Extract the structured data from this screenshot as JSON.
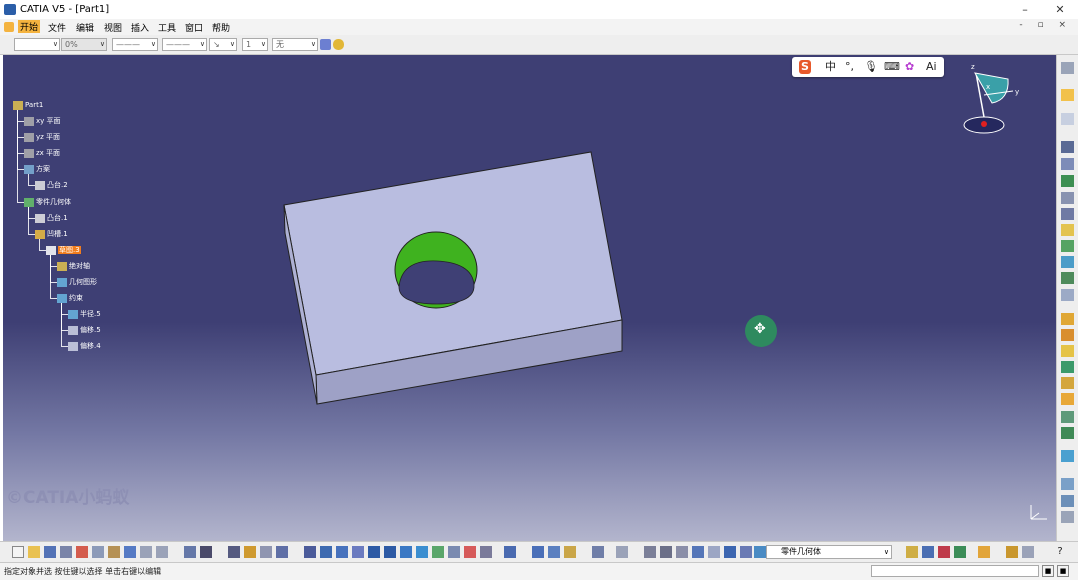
{
  "window": {
    "title": "CATIA V5 - [Part1]",
    "minimize": "–",
    "maximize": "□",
    "close": "✕"
  },
  "menu": {
    "items": [
      "开始",
      "文件",
      "编辑",
      "视图",
      "插入",
      "工具",
      "窗口",
      "帮助"
    ],
    "active_index": 0,
    "doc_controls": "- ▫ ×"
  },
  "format_toolbar": {
    "font_combo": "",
    "percent_combo": "0%",
    "line_type_combo": "———",
    "line_weight_combo": "———",
    "arrow_combo": "↘",
    "layer_combo": "1",
    "filter_combo": "无"
  },
  "spec_tree": {
    "nodes": [
      {
        "label": "Part1",
        "icon": "part-icon",
        "level": 0
      },
      {
        "label": "xy 平面",
        "icon": "plane-icon",
        "level": 1
      },
      {
        "label": "yz 平面",
        "icon": "plane-icon",
        "level": 1
      },
      {
        "label": "zx 平面",
        "icon": "plane-icon",
        "level": 1
      },
      {
        "label": "方案",
        "icon": "sketch-folder-icon",
        "level": 1
      },
      {
        "label": "凸台.2",
        "icon": "pad-icon",
        "level": 2
      },
      {
        "label": "零件几何体",
        "icon": "body-icon",
        "level": 1
      },
      {
        "label": "凸台.1",
        "icon": "pad-icon",
        "level": 2
      },
      {
        "label": "凹槽.1",
        "icon": "pocket-icon",
        "level": 2
      },
      {
        "label": "草图.3",
        "icon": "sketch-icon",
        "level": 3,
        "selected": true
      },
      {
        "label": "绝对轴",
        "icon": "axis-icon",
        "level": 4
      },
      {
        "label": "几何图形",
        "icon": "geometry-icon",
        "level": 4
      },
      {
        "label": "约束",
        "icon": "constraint-icon",
        "level": 4
      },
      {
        "label": "半径.5",
        "icon": "radius-icon",
        "level": 5
      },
      {
        "label": "偏移.5",
        "icon": "offset-icon",
        "level": 5
      },
      {
        "label": "偏移.4",
        "icon": "offset-icon",
        "level": 5
      }
    ]
  },
  "ime_toolbar": {
    "items": [
      "S",
      "中",
      "°,",
      "mic-icon",
      "keyboard-icon",
      "skin-icon",
      "Ai"
    ]
  },
  "compass": {
    "x_label": "x",
    "y_label": "y",
    "z_label": "z"
  },
  "watermark": "©CATIA小蚂蚁",
  "colors": {
    "part_top": "#b9bde0",
    "part_front": "#9ea1c6",
    "part_side": "#aeb1d4",
    "hole_wall": "#3fb21f",
    "selection": "#f17d1e",
    "background_top": "#3e3f74"
  },
  "workbench_combo": "零件几何体",
  "status": {
    "message": "指定对象并选  按住键以选择  单击右键以编辑"
  }
}
